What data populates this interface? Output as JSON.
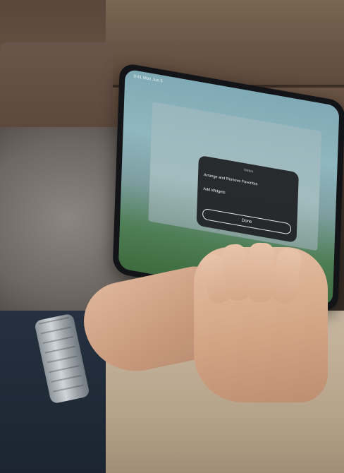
{
  "ipad_screen": {
    "status_time": "9:41 Mon Jun 5",
    "modal": {
      "title": "Notes",
      "items": [
        {
          "label": "Arrange and Remove Favorites"
        },
        {
          "label": "Add Widgets"
        }
      ],
      "done_label": "Done"
    }
  }
}
